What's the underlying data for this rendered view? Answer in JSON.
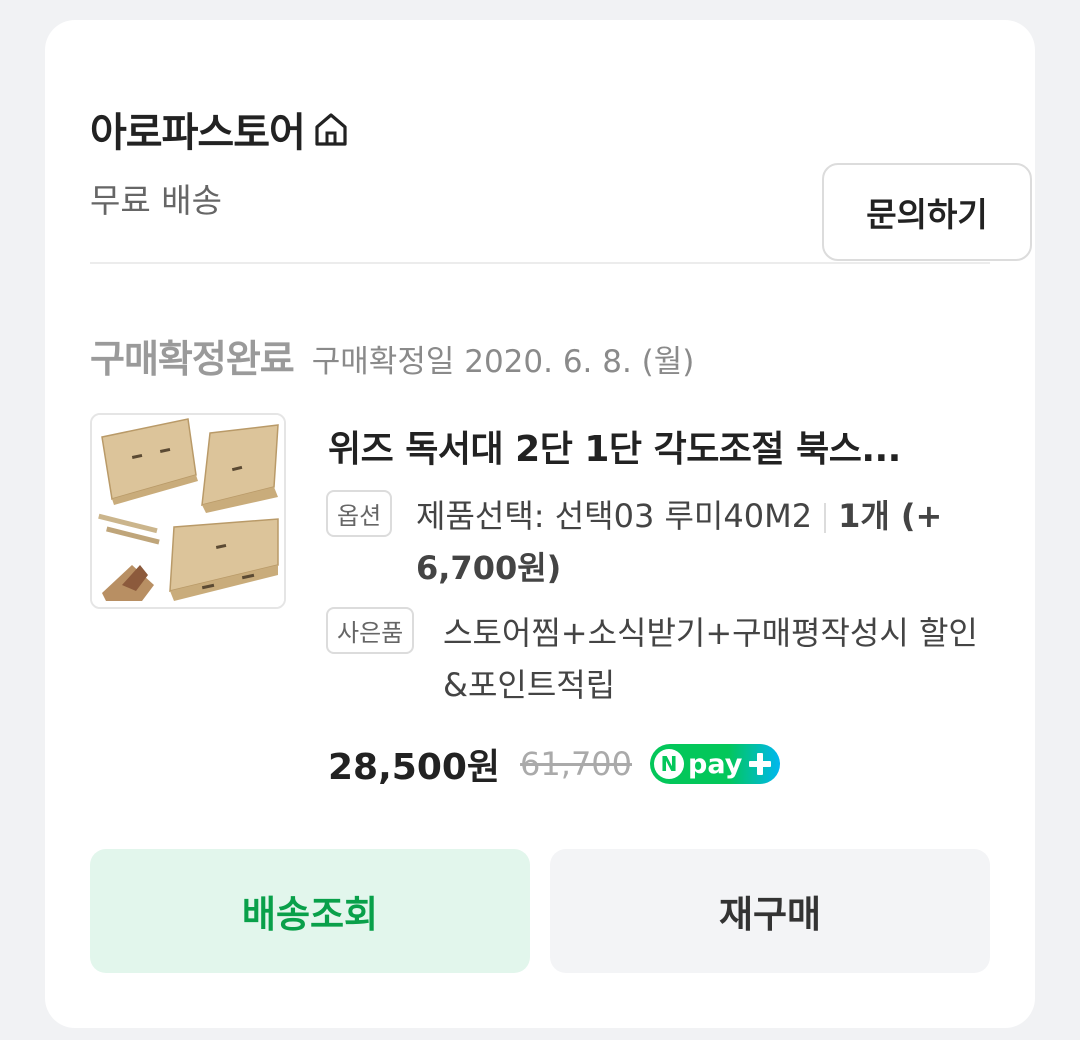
{
  "store": {
    "name": "아로파스토어",
    "shipping": "무료 배송",
    "inquiry_label": "문의하기"
  },
  "order": {
    "status": "구매확정완료",
    "confirm_date": "구매확정일 2020. 6. 8. (월)"
  },
  "product": {
    "title": "위즈 독서대 2단 1단 각도조절 북스...",
    "option_tag": "옵션",
    "option_text": "제품선택: 선택03 루미40M2",
    "option_qty": "1개 (+ 6,700원)",
    "gift_tag": "사은품",
    "gift_text": "스토어찜+소식받기+구매평작성시 할인&포인트적립",
    "price": "28,500원",
    "original_price": "61,700",
    "npay_n": "N",
    "npay_text": "pay"
  },
  "actions": {
    "track_label": "배송조회",
    "rebuy_label": "재구매"
  },
  "colors": {
    "accent_green": "#03c75a",
    "track_bg": "#e2f6ec",
    "status_gray": "#9a9a9a"
  },
  "icons": {
    "store_home": "home-icon",
    "npay_plus": "plus-icon"
  }
}
